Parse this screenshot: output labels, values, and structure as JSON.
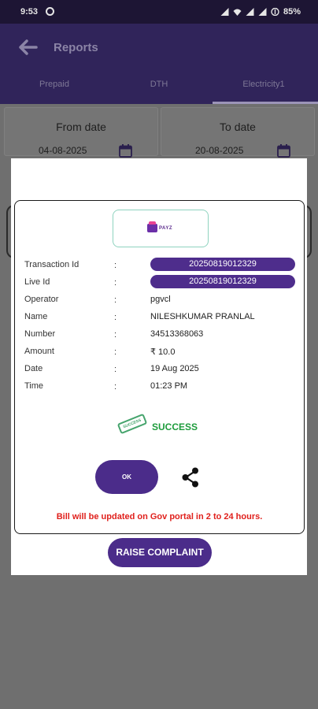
{
  "status_bar": {
    "time": "9:53",
    "battery": "85%"
  },
  "header": {
    "title": "Reports"
  },
  "tabs": [
    {
      "label": "Prepaid"
    },
    {
      "label": "DTH"
    },
    {
      "label": "Electricity1"
    }
  ],
  "filters": {
    "from_label": "From date",
    "from_value": "04-08-2025",
    "to_label": "To date",
    "to_value": "20-08-2025"
  },
  "receipt": {
    "logo_text": "PAYZ",
    "rows": [
      {
        "label": "Transaction Id",
        "colon": ":",
        "value": "20250819012329"
      },
      {
        "label": "Live Id",
        "colon": ":",
        "value": "20250819012329"
      },
      {
        "label": "Operator",
        "colon": ":",
        "value": "pgvcl"
      },
      {
        "label": "Name",
        "colon": ":",
        "value": "NILESHKUMAR PRANLAL"
      },
      {
        "label": "Number",
        "colon": ":",
        "value": "34513368063"
      },
      {
        "label": "Amount",
        "colon": ":",
        "value": "₹ 10.0"
      },
      {
        "label": "Date",
        "colon": ":",
        "value": "19 Aug 2025"
      },
      {
        "label": "Time",
        "colon": ":",
        "value": "01:23 PM"
      }
    ],
    "stamp_text": "SUCCESS",
    "status": "SUCCESS",
    "ok_label": "OK",
    "note": "Bill will be updated on Gov portal in 2 to 24 hours."
  },
  "actions": {
    "raise_complaint_label": "RAISE COMPLAINT"
  },
  "colors": {
    "primary": "#4b2c8a",
    "success": "#1e9c3c",
    "warning": "#e0201c"
  },
  "icons": {
    "back": "arrow-back-icon",
    "calendar": "calendar-icon",
    "share": "share-icon"
  }
}
